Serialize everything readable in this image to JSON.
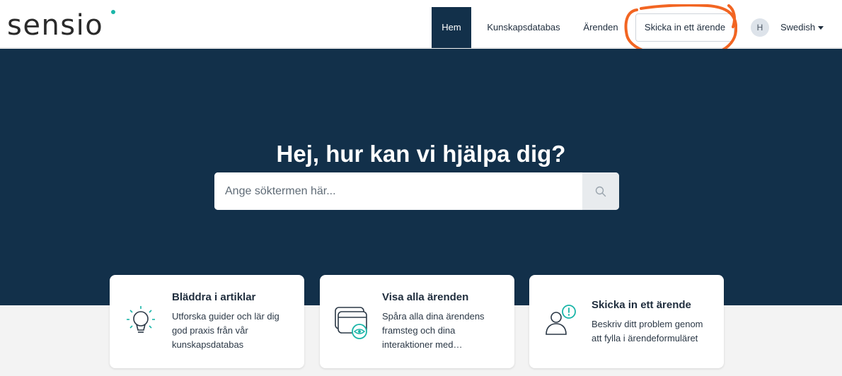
{
  "brand": {
    "logo_text": "sensio"
  },
  "nav": {
    "home": "Hem",
    "knowledge_base": "Kunskapsdatabas",
    "cases": "Ärenden",
    "submit_case": "Skicka in ett ärende"
  },
  "user": {
    "avatar_initial": "H",
    "language": "Swedish"
  },
  "hero": {
    "title": "Hej, hur kan vi hjälpa dig?"
  },
  "search": {
    "placeholder": "Ange söktermen här..."
  },
  "cards": [
    {
      "icon": "lightbulb-icon",
      "title": "Bläddra i artiklar",
      "description": "Utforska guider och lär dig god praxis från vår kunskapsdatabas"
    },
    {
      "icon": "cards-eye-icon",
      "title": "Visa alla ärenden",
      "description": "Spåra alla dina ärendens framsteg och dina interaktioner med…"
    },
    {
      "icon": "person-alert-icon",
      "title": "Skicka in ett ärende",
      "description": "Beskriv ditt problem genom att fylla i ärendeformuläret"
    }
  ],
  "colors": {
    "hero_bg": "#12304a",
    "accent": "#1ab5a8",
    "annotation": "#f26522"
  }
}
